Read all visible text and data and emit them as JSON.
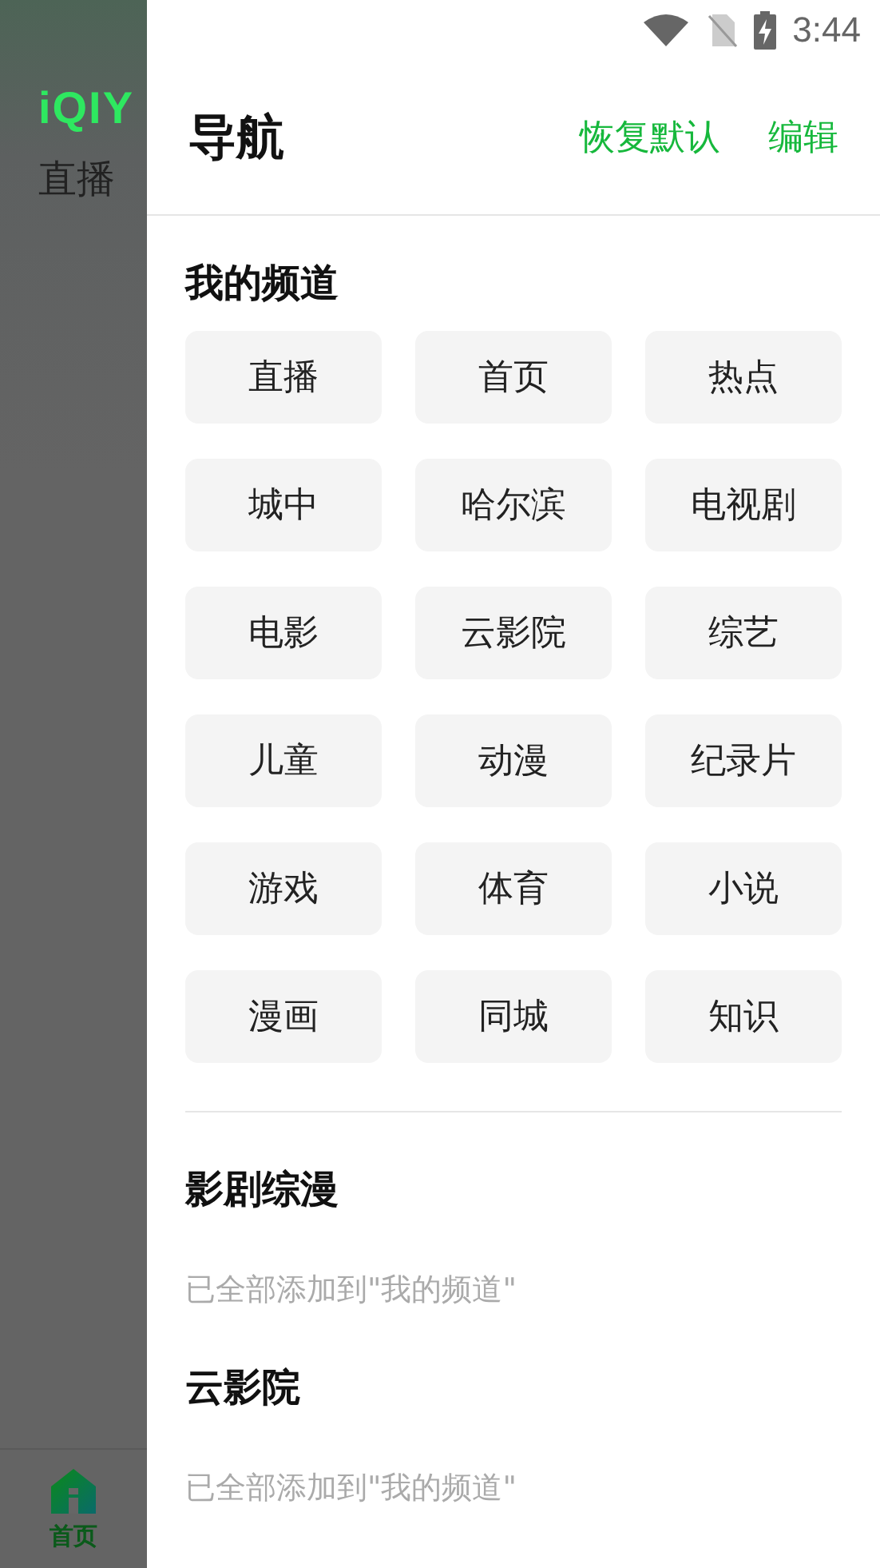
{
  "status_bar": {
    "time": "3:44"
  },
  "background_app": {
    "logo": "iQIY",
    "top_tab": "直播",
    "bottom_nav": {
      "label": "首页",
      "selected": true
    }
  },
  "drawer": {
    "title": "导航",
    "actions": [
      "恢复默认",
      "编辑"
    ],
    "my_channels": {
      "heading": "我的频道",
      "items": [
        "直播",
        "首页",
        "热点",
        "城中",
        "哈尔滨",
        "电视剧",
        "电影",
        "云影院",
        "综艺",
        "儿童",
        "动漫",
        "纪录片",
        "游戏",
        "体育",
        "小说",
        "漫画",
        "同城",
        "知识"
      ]
    },
    "sections": [
      {
        "heading": "影剧综漫",
        "note": "已全部添加到\"我的频道\""
      },
      {
        "heading": "云影院",
        "note": "已全部添加到\"我的频道\""
      }
    ]
  }
}
